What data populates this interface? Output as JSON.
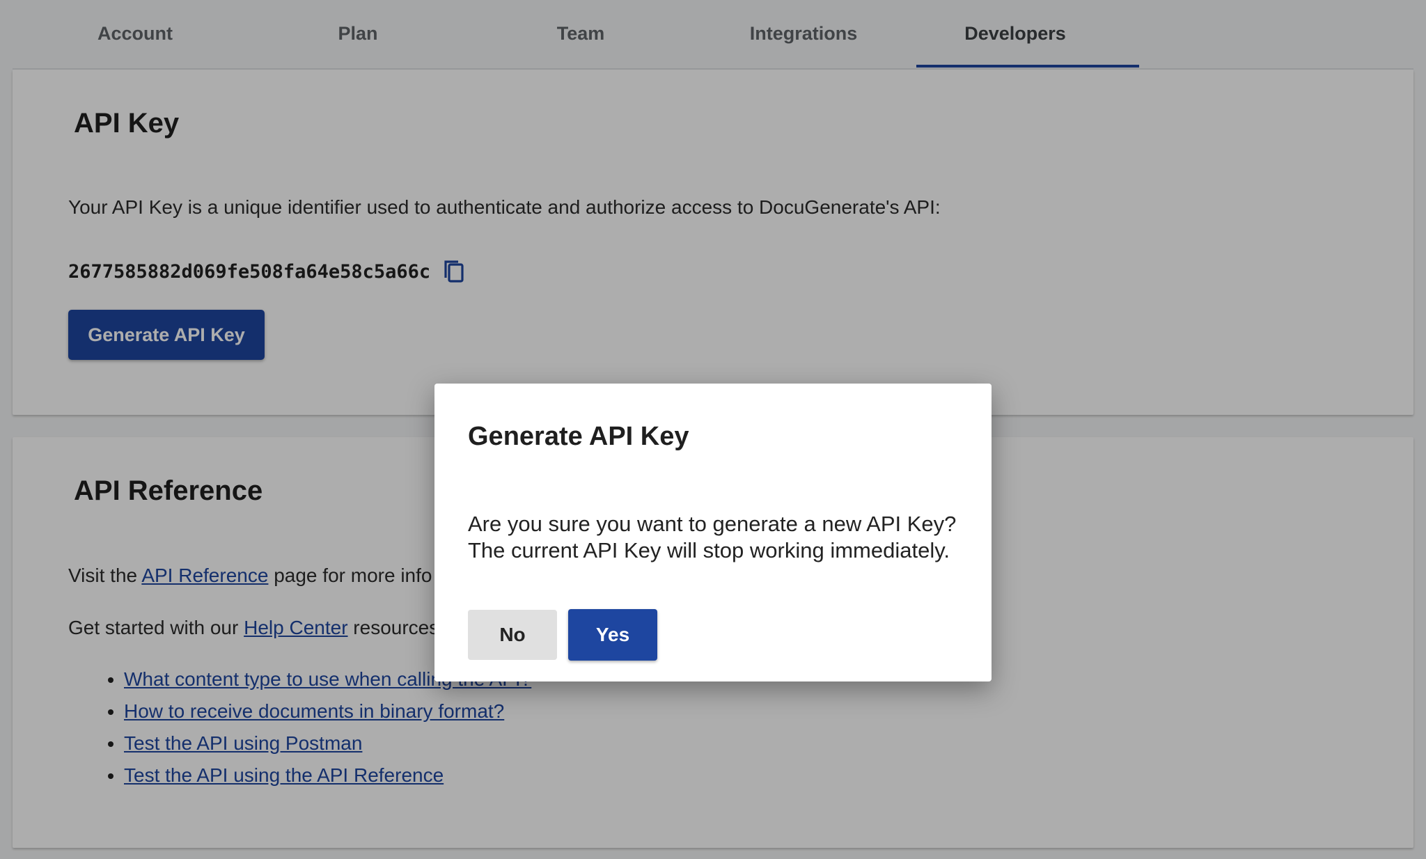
{
  "tabs": [
    {
      "label": "Account",
      "active": false
    },
    {
      "label": "Plan",
      "active": false
    },
    {
      "label": "Team",
      "active": false
    },
    {
      "label": "Integrations",
      "active": false
    },
    {
      "label": "Developers",
      "active": true
    }
  ],
  "api_key_card": {
    "title": "API Key",
    "description": "Your API Key is a unique identifier used to authenticate and authorize access to DocuGenerate's API:",
    "key_value": "2677585882d069fe508fa64e58c5a66c",
    "copy_icon": "copy-icon",
    "generate_button": "Generate API Key"
  },
  "api_reference_card": {
    "title": "API Reference",
    "p1_prefix": "Visit the ",
    "p1_link": "API Reference",
    "p1_suffix": " page for more info o",
    "p2_prefix": "Get started with our ",
    "p2_link": "Help Center",
    "p2_suffix": " resources:",
    "links": [
      "What content type to use when calling the API?",
      "How to receive documents in binary format?",
      "Test the API using Postman",
      "Test the API using the API Reference"
    ]
  },
  "dialog": {
    "title": "Generate API Key",
    "line1": "Are you sure you want to generate a new API Key?",
    "line2": "The current API Key will stop working immediately.",
    "no_label": "No",
    "yes_label": "Yes"
  },
  "colors": {
    "primary": "#1e46a0",
    "overlay": "rgba(0,0,0,0.32)",
    "secondary_button": "#e0e0e0"
  }
}
